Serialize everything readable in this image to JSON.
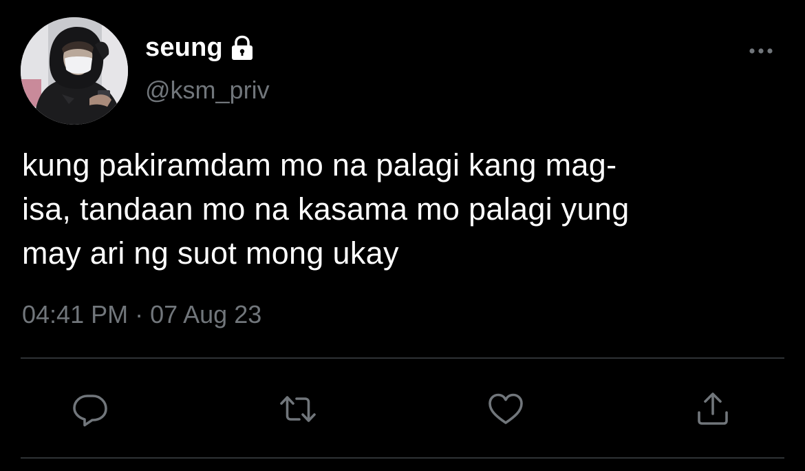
{
  "tweet": {
    "display_name": "seung",
    "handle": "@ksm_priv",
    "protected": true,
    "text_lines": [
      "kung pakiramdam mo na palagi kang mag-",
      "isa, tandaan mo na kasama mo palagi yung",
      "may ari ng suot mong ukay"
    ],
    "timestamp": "04:41 PM · 07 Aug 23"
  },
  "icons": {
    "lock": "lock-icon",
    "more": "more-dots-icon",
    "reply": "reply-icon",
    "retweet": "retweet-icon",
    "like": "heart-icon",
    "share": "share-icon"
  },
  "colors": {
    "background": "#000000",
    "primary_text": "#ffffff",
    "secondary_text": "#71767b",
    "divider": "#2f3336"
  }
}
